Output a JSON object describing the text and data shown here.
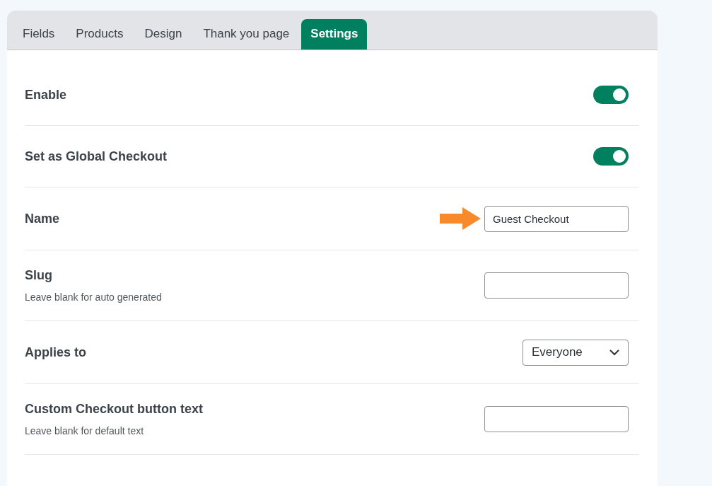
{
  "tabs": [
    {
      "label": "Fields",
      "selected": false
    },
    {
      "label": "Products",
      "selected": false
    },
    {
      "label": "Design",
      "selected": false
    },
    {
      "label": "Thank you page",
      "selected": false
    },
    {
      "label": "Settings",
      "selected": true
    }
  ],
  "settings": [
    {
      "kind": "toggle",
      "label": "Enable",
      "on": true
    },
    {
      "kind": "toggle",
      "label": "Set as Global Checkout",
      "on": true
    },
    {
      "kind": "text",
      "label": "Name",
      "value": "Guest Checkout",
      "pointed": true
    },
    {
      "kind": "text",
      "label": "Slug",
      "help": "Leave blank for auto generated",
      "pointed": false
    },
    {
      "kind": "select",
      "label": "Applies to",
      "value": "Everyone"
    },
    {
      "kind": "text",
      "label": "Custom Checkout button text",
      "help": "Leave blank for default text",
      "pointed": false
    }
  ]
}
